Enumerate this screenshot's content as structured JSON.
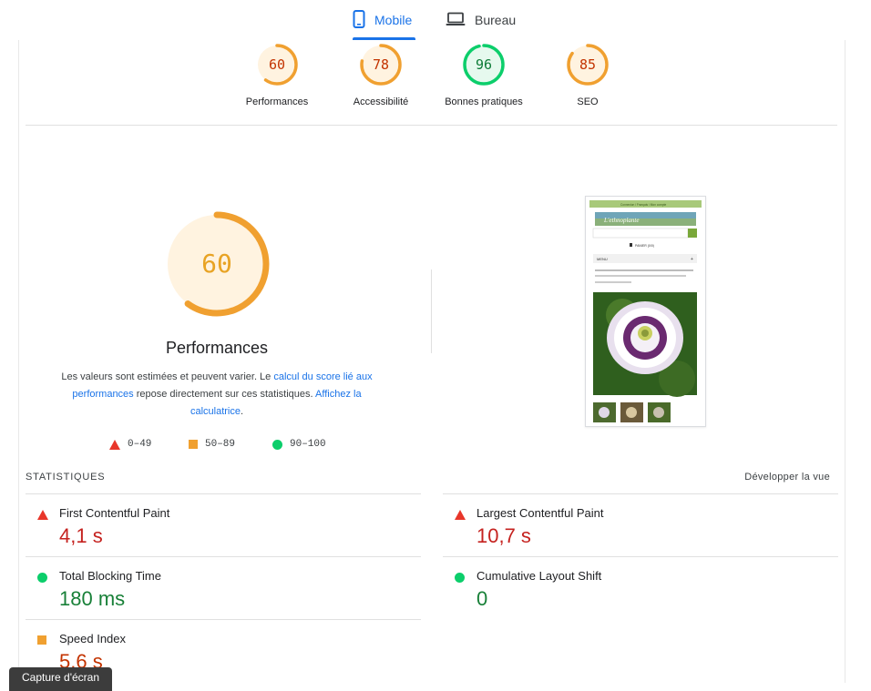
{
  "tabs": {
    "mobile": "Mobile",
    "desktop": "Bureau"
  },
  "categories": [
    {
      "score": "60",
      "label": "Performances",
      "value": 60,
      "color": "#f0a030"
    },
    {
      "score": "78",
      "label": "Accessibilité",
      "value": 78,
      "color": "#f0a030"
    },
    {
      "score": "96",
      "label": "Bonnes pratiques",
      "value": 96,
      "color": "#0cce6b"
    },
    {
      "score": "85",
      "label": "SEO",
      "value": 85,
      "color": "#f0a030"
    }
  ],
  "performance": {
    "score": "60",
    "value": 60,
    "title": "Performances",
    "desc_part1": "Les valeurs sont estimées et peuvent varier. Le ",
    "desc_link1": "calcul du score lié aux performances",
    "desc_part2": " repose directement sur ces statistiques. ",
    "desc_link2": "Affichez la calculatrice",
    "desc_part3": "."
  },
  "legend": [
    {
      "range": "0–49",
      "icon": "triangle-red"
    },
    {
      "range": "50–89",
      "icon": "square-orange"
    },
    {
      "range": "90–100",
      "icon": "circle-green"
    }
  ],
  "thumbnail": {
    "header_text": "Connexion / Français / Mon compte",
    "logo_text": "L'ethnoplante",
    "cart_text": "PANIER (0/0)",
    "menu_text": "MENU",
    "breadcrumb_text": "Plantes, graines ethnobotaniques et champignons > Ethnobotaniques > Passiflora incarnata (PASSIFLORE / MARACUJA) graines"
  },
  "statistics": {
    "title": "STATISTIQUES",
    "toggle": "Développer la vue",
    "metrics": [
      {
        "name": "First Contentful Paint",
        "value": "4,1 s",
        "status": "red"
      },
      {
        "name": "Largest Contentful Paint",
        "value": "10,7 s",
        "status": "red"
      },
      {
        "name": "Total Blocking Time",
        "value": "180 ms",
        "status": "green"
      },
      {
        "name": "Cumulative Layout Shift",
        "value": "0",
        "status": "green"
      },
      {
        "name": "Speed Index",
        "value": "5,6 s",
        "status": "orange"
      }
    ]
  },
  "tooltip": "Capture d'écran"
}
